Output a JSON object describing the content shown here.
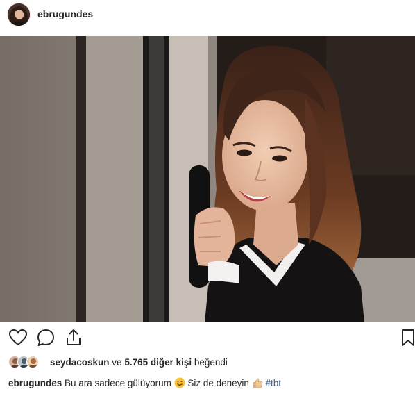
{
  "post": {
    "username": "ebrugundes",
    "photo_icon": "portrait-photo",
    "actions": {
      "like_icon": "heart-icon",
      "comment_icon": "comment-icon",
      "share_icon": "share-icon",
      "save_icon": "bookmark-icon"
    },
    "likes": {
      "first_liker": "seydacoskun",
      "connector": " ve ",
      "count_text": "5.765 diğer kişi",
      "suffix": " beğendi"
    },
    "caption": {
      "user": "ebrugundes",
      "text1": " Bu ara sadece gülüyorum ",
      "text2": " Siz de deneyin ",
      "hashtag": "#tbt",
      "emoji1": "smile-emoji",
      "emoji2": "thumbs-up-emoji"
    }
  },
  "colors": {
    "text": "#262626",
    "hashtag": "#3b5f9a",
    "background": "#ffffff"
  }
}
